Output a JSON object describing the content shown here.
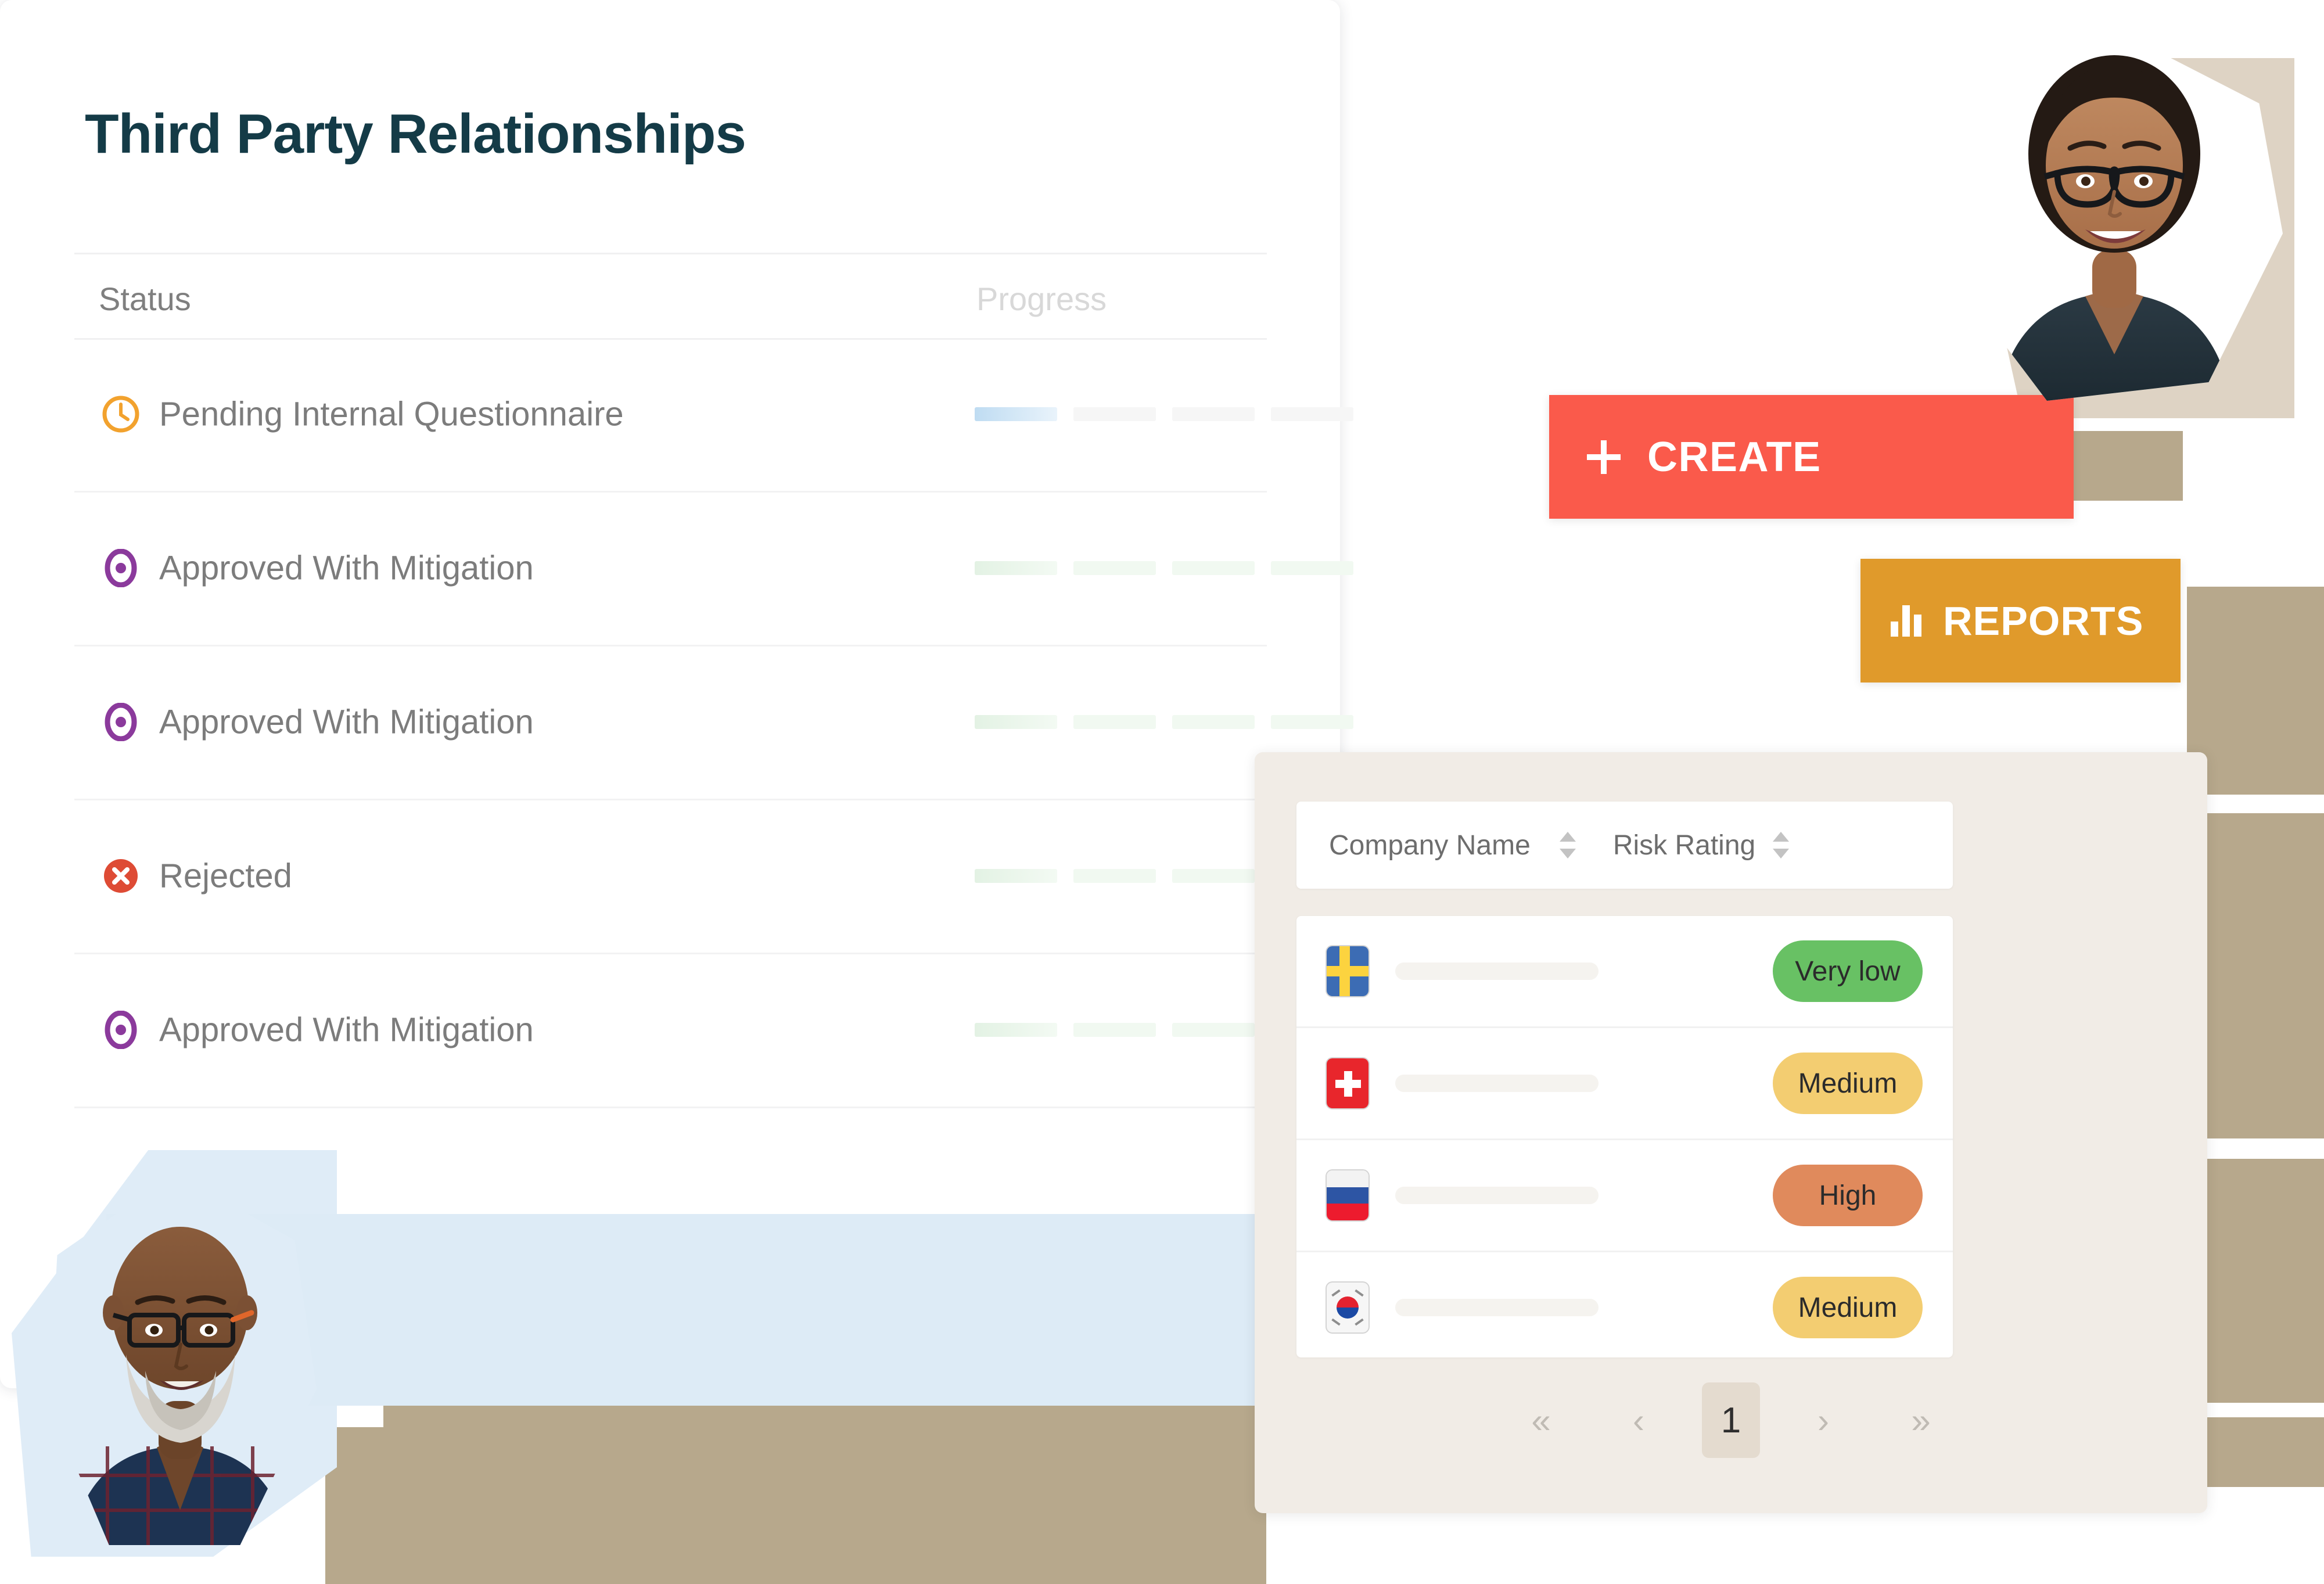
{
  "card": {
    "title": "Third Party Relationships",
    "columns": {
      "status": "Status",
      "progress": "Progress"
    },
    "rows": [
      {
        "status": "Pending Internal Questionnaire",
        "icon": "clock-icon",
        "icon_color": "#f2a22e",
        "progress_tone": "blue"
      },
      {
        "status": "Approved With Mitigation",
        "icon": "eye-icon",
        "icon_color": "#8b3a9c",
        "progress_tone": "green"
      },
      {
        "status": "Approved With Mitigation",
        "icon": "eye-icon",
        "icon_color": "#8b3a9c",
        "progress_tone": "green"
      },
      {
        "status": "Rejected",
        "icon": "x-circle-icon",
        "icon_color": "#de4b35",
        "progress_tone": "green"
      },
      {
        "status": "Approved With Mitigation",
        "icon": "eye-icon",
        "icon_color": "#8b3a9c",
        "progress_tone": "green"
      }
    ]
  },
  "buttons": {
    "create": {
      "label": "CREATE",
      "icon": "plus-icon",
      "color": "#fa5a4b"
    },
    "reports": {
      "label": "REPORTS",
      "icon": "bar-chart-icon",
      "color": "#e09a2b"
    }
  },
  "right_panel": {
    "headers": [
      {
        "label": "Company Name",
        "sortable": true
      },
      {
        "label": "Risk Rating",
        "sortable": true
      }
    ],
    "rows": [
      {
        "flag": "sweden-flag",
        "company_name": "",
        "risk": "Very low",
        "risk_color": "#68c164"
      },
      {
        "flag": "switzerland-flag",
        "company_name": "",
        "risk": "Medium",
        "risk_color": "#f3cd71"
      },
      {
        "flag": "russia-flag",
        "company_name": "",
        "risk": "High",
        "risk_color": "#e08a5c"
      },
      {
        "flag": "south-korea-flag",
        "company_name": "",
        "risk": "Medium",
        "risk_color": "#f3cd71"
      }
    ],
    "pagination": {
      "first": "«",
      "prev": "‹",
      "current_page": "1",
      "next": "›",
      "last": "»"
    }
  },
  "colors": {
    "title": "#143b47",
    "panel_bg": "#f1ece6",
    "card_bg": "#ffffff",
    "accent_red": "#fa5a4b",
    "accent_orange": "#e09a2b",
    "strip_blue": "#ddebf6",
    "tan": "#b7a88c"
  }
}
